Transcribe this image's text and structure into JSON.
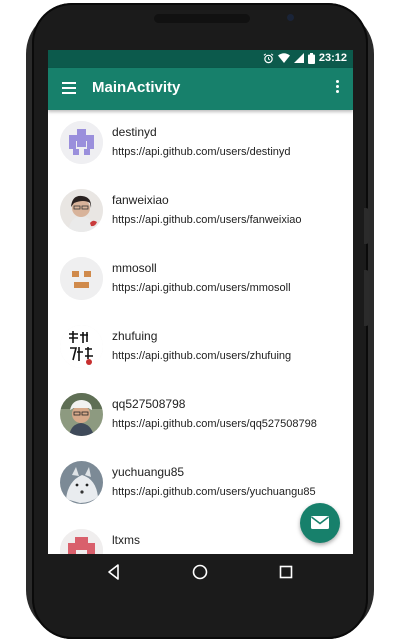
{
  "status_bar": {
    "time": "23:12",
    "icons": [
      "alarm-icon",
      "wifi-icon",
      "signal-icon",
      "battery-icon"
    ]
  },
  "toolbar": {
    "title": "MainActivity",
    "menu_icon": "hamburger-icon",
    "overflow_icon": "more-vert-icon"
  },
  "users": [
    {
      "login": "destinyd",
      "url": "https://api.github.com/users/destinyd"
    },
    {
      "login": "fanweixiao",
      "url": "https://api.github.com/users/fanweixiao"
    },
    {
      "login": "mmosoll",
      "url": "https://api.github.com/users/mmosoll"
    },
    {
      "login": "zhufuing",
      "url": "https://api.github.com/users/zhufuing"
    },
    {
      "login": "qq527508798",
      "url": "https://api.github.com/users/qq527508798"
    },
    {
      "login": "yuchuangu85",
      "url": "https://api.github.com/users/yuchuangu85"
    },
    {
      "login": "ltxms",
      "url": ""
    }
  ],
  "fab": {
    "icon": "email-icon"
  },
  "nav_bar": {
    "icons": [
      "back-icon",
      "home-icon",
      "recents-icon"
    ]
  },
  "colors": {
    "primary": "#17806b",
    "primary_dark": "#0c5a4c",
    "text": "#212121"
  }
}
